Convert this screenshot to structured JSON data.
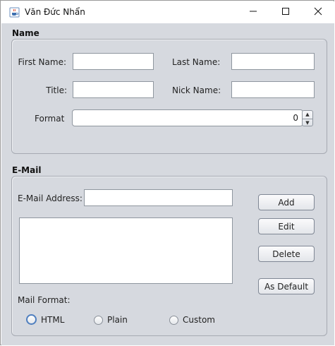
{
  "window": {
    "title": "Văn Đức Nhẩn",
    "icons": {
      "app": "java-cup-icon",
      "minimize": "minimize-icon",
      "maximize": "maximize-icon",
      "close": "close-icon"
    }
  },
  "name_section": {
    "title": "Name",
    "first_name_label": "First Name:",
    "first_name_value": "",
    "last_name_label": "Last Name:",
    "last_name_value": "",
    "title_label": "Title:",
    "title_value": "",
    "nick_name_label": "Nick Name:",
    "nick_name_value": "",
    "format_label": "Format",
    "format_value": "0"
  },
  "email_section": {
    "title": "E-Mail",
    "address_label": "E-Mail Address:",
    "address_value": "",
    "buttons": {
      "add": "Add",
      "edit": "Edit",
      "delete": "Delete",
      "as_default": "As Default"
    },
    "mail_format_label": "Mail Format:",
    "formats": [
      {
        "label": "HTML",
        "selected": true
      },
      {
        "label": "Plain",
        "selected": false
      },
      {
        "label": "Custom",
        "selected": false
      }
    ]
  },
  "colors": {
    "panel_bg": "#d6d9df",
    "selected_radio": "#4f7fbf"
  }
}
